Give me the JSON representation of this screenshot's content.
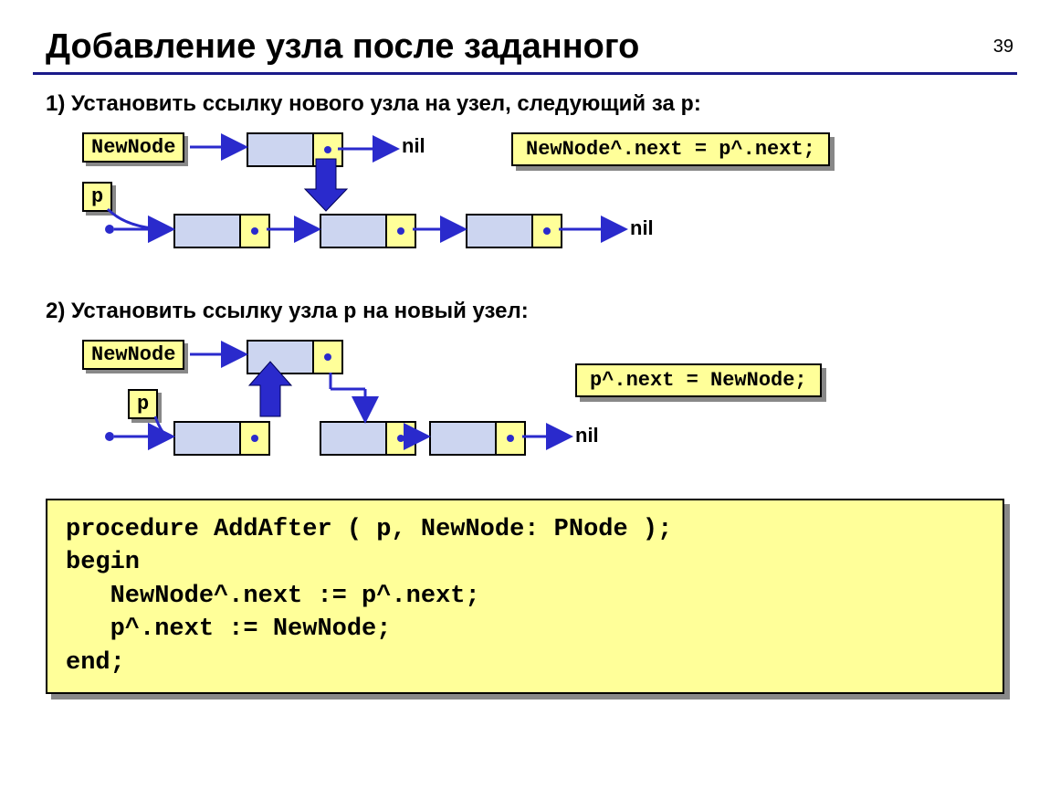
{
  "page_number": "39",
  "title": "Добавление узла после заданного",
  "step1": {
    "prefix": "1) Установить ссылку нового узла на узел, следующий за ",
    "p_token": "p",
    "suffix": ":",
    "label_newnode": "NewNode",
    "label_p": "p",
    "nil_top": "nil",
    "nil_bottom": "nil",
    "code": "NewNode^.next = p^.next;"
  },
  "step2": {
    "prefix": "2) Установить ссылку узла ",
    "p_token": "p",
    "suffix": " на новый узел:",
    "label_newnode": "NewNode",
    "label_p": "p",
    "nil_bottom": "nil",
    "code": "p^.next = NewNode;"
  },
  "code_block": "procedure AddAfter ( p, NewNode: PNode );\nbegin\n   NewNode^.next := p^.next;\n   p^.next := NewNode;\nend;"
}
